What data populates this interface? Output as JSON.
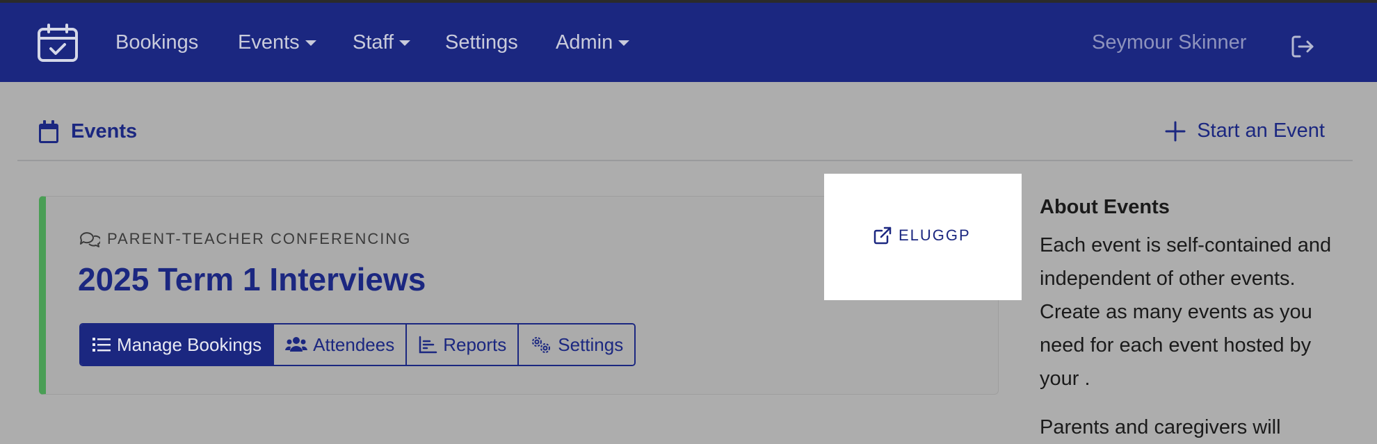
{
  "nav": {
    "items": [
      {
        "label": "Bookings",
        "dropdown": false
      },
      {
        "label": "Events",
        "dropdown": true
      },
      {
        "label": "Staff",
        "dropdown": true
      },
      {
        "label": "Settings",
        "dropdown": false
      },
      {
        "label": "Admin",
        "dropdown": true
      }
    ],
    "user_name": "Seymour Skinner",
    "logo_icon": "calendar-check-icon",
    "logout_icon": "logout-icon"
  },
  "page_header": {
    "title": "Events",
    "start_label": "Start an Event"
  },
  "event": {
    "type": "PARENT-TEACHER CONFERENCING",
    "title": "2025 Term 1 Interviews",
    "code": "ELUGGP",
    "buttons": {
      "manage": "Manage Bookings",
      "attendees": "Attendees",
      "reports": "Reports",
      "settings": "Settings"
    }
  },
  "about": {
    "heading": "About Events",
    "paragraph1": "Each event is self-contained and independent of other events. Create as many events as you need for each event hosted by your .",
    "paragraph2": "Parents and caregivers will"
  },
  "colors": {
    "navbar": "#1b2780",
    "accent": "#1b2780",
    "card_stripe": "#4a9e55",
    "overlay": "#adadad"
  }
}
